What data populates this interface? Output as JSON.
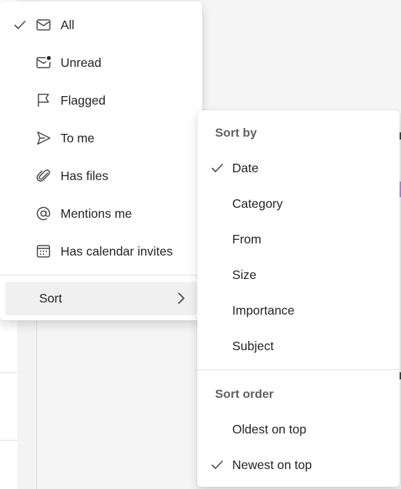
{
  "filter_menu": {
    "items": [
      {
        "label": "All",
        "icon": "mail-icon",
        "checked": true
      },
      {
        "label": "Unread",
        "icon": "mail-unread-icon",
        "checked": false
      },
      {
        "label": "Flagged",
        "icon": "flag-icon",
        "checked": false
      },
      {
        "label": "To me",
        "icon": "send-icon",
        "checked": false
      },
      {
        "label": "Has files",
        "icon": "paperclip-icon",
        "checked": false
      },
      {
        "label": "Mentions me",
        "icon": "at-icon",
        "checked": false
      },
      {
        "label": "Has calendar invites",
        "icon": "calendar-icon",
        "checked": false
      }
    ],
    "sort_label": "Sort"
  },
  "sort_menu": {
    "sort_by_header": "Sort by",
    "sort_by_items": [
      {
        "label": "Date",
        "checked": true
      },
      {
        "label": "Category",
        "checked": false
      },
      {
        "label": "From",
        "checked": false
      },
      {
        "label": "Size",
        "checked": false
      },
      {
        "label": "Importance",
        "checked": false
      },
      {
        "label": "Subject",
        "checked": false
      }
    ],
    "sort_order_header": "Sort order",
    "sort_order_items": [
      {
        "label": "Oldest on top",
        "checked": false
      },
      {
        "label": "Newest on top",
        "checked": true
      }
    ]
  },
  "colors": {
    "text": "#242424",
    "header": "#616161",
    "accent_purple": "#b88ad6"
  }
}
